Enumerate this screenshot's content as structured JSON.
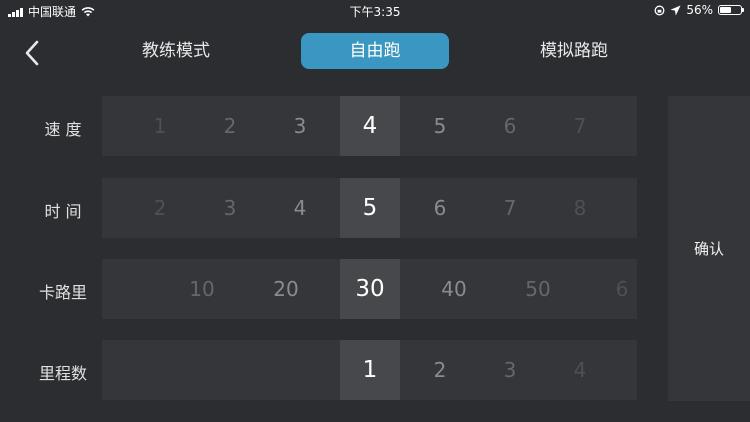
{
  "status_bar": {
    "carrier": "中国联通",
    "time": "下午3:35",
    "battery": "56%",
    "battery_level": 0.56
  },
  "header": {
    "back_icon": "chevron-left-icon",
    "tabs": [
      {
        "label": "教练模式",
        "active": false
      },
      {
        "label": "自由跑",
        "active": true
      },
      {
        "label": "模拟路跑",
        "active": false
      }
    ]
  },
  "pickers": [
    {
      "label": "速 度",
      "values": [
        "1",
        "2",
        "3",
        "4",
        "5",
        "6",
        "7"
      ],
      "selected": "4"
    },
    {
      "label": "时 间",
      "values": [
        "2",
        "3",
        "4",
        "5",
        "6",
        "7",
        "8"
      ],
      "selected": "5"
    },
    {
      "label": "卡路里",
      "values": [
        "10",
        "20",
        "30",
        "40",
        "50",
        "6"
      ],
      "selected": "30"
    },
    {
      "label": "里程数",
      "values": [
        "1",
        "2",
        "3",
        "4"
      ],
      "selected": "1"
    }
  ],
  "confirm_label": "确认",
  "colors": {
    "background": "#2b2d30",
    "accent": "#3a97c1",
    "picker_bg": "#353639",
    "picker_selected_bg": "#47484b"
  }
}
